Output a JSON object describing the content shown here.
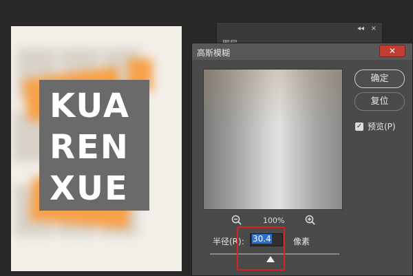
{
  "document": {
    "logo_lines": [
      "KUA",
      "REN",
      "XUE"
    ]
  },
  "panel": {
    "collapse_icon": "double-chevron-icon",
    "close_label": "×",
    "tab_label": "图层"
  },
  "dialog": {
    "title": "高斯模糊",
    "close_label": "✕",
    "ok_label": "确定",
    "reset_label": "复位",
    "preview_label": "预览(P)",
    "preview_checked": true,
    "zoom_level": "100%",
    "radius_label": "半径(R):",
    "radius_value": "30.4",
    "unit_label": "像素",
    "slider_fraction": 0.47,
    "highlight_color": "#e02020"
  }
}
